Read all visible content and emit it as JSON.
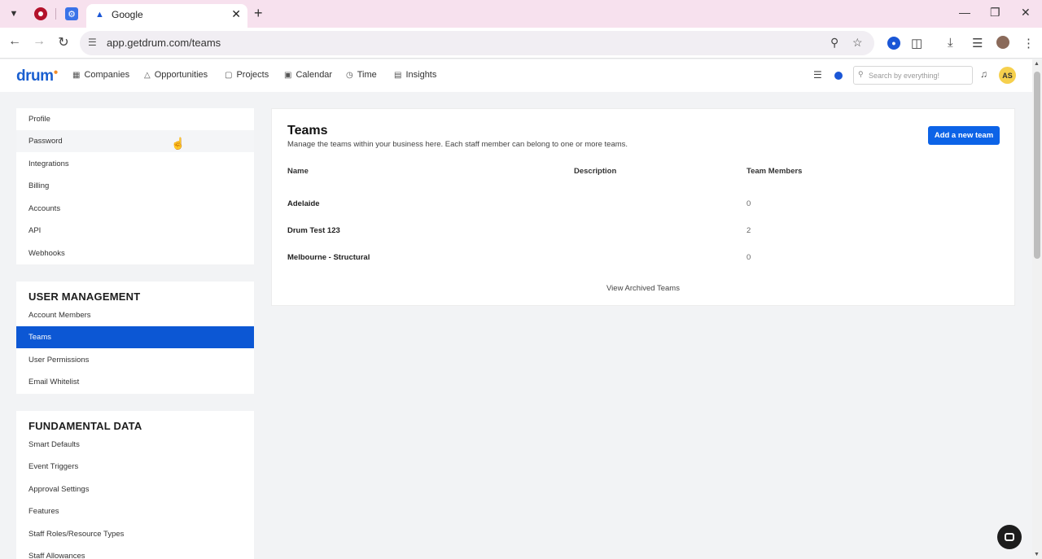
{
  "browser": {
    "tab_title": "Google",
    "url": "app.getdrum.com/teams",
    "icons": [
      "chevron-down-icon",
      "record-icon",
      "settings-icon",
      "close-icon",
      "plus-icon",
      "minimize-icon",
      "restore-icon",
      "back-icon",
      "forward-icon",
      "reload-icon",
      "site-info-icon",
      "zoom-icon",
      "star-icon",
      "password-icon",
      "extensions-icon",
      "download-icon",
      "media-icon",
      "profile-icon",
      "kebab-icon"
    ]
  },
  "header": {
    "logo": "drum",
    "nav": [
      {
        "label": "Companies",
        "icon": "building-icon"
      },
      {
        "label": "Opportunities",
        "icon": "opportunity-icon"
      },
      {
        "label": "Projects",
        "icon": "folder-icon"
      },
      {
        "label": "Calendar",
        "icon": "calendar-icon"
      },
      {
        "label": "Time",
        "icon": "clock-icon"
      },
      {
        "label": "Insights",
        "icon": "insights-icon"
      }
    ],
    "search_placeholder": "Search by everything!",
    "avatar_initials": "AS"
  },
  "sidebar": {
    "account": [
      "Profile",
      "Password",
      "Integrations",
      "Billing",
      "Accounts",
      "API",
      "Webhooks"
    ],
    "user_management": {
      "heading": "USER MANAGEMENT",
      "items": [
        "Account Members",
        "Teams",
        "User Permissions",
        "Email Whitelist"
      ],
      "active": "Teams"
    },
    "fundamental_data": {
      "heading": "FUNDAMENTAL DATA",
      "items": [
        "Smart Defaults",
        "Event Triggers",
        "Approval Settings",
        "Features",
        "Staff Roles/Resource Types",
        "Staff Allowances"
      ]
    }
  },
  "main": {
    "title": "Teams",
    "subtitle": "Manage the teams within your business here. Each staff member can belong to one or more teams.",
    "add_button": "Add a new team",
    "columns": [
      "Name",
      "Description",
      "Team Members"
    ],
    "rows": [
      {
        "name": "Adelaide",
        "description": "",
        "members": "0"
      },
      {
        "name": "Drum Test 123",
        "description": "",
        "members": "2"
      },
      {
        "name": "Melbourne - Structural",
        "description": "",
        "members": "0"
      }
    ],
    "archived_link": "View Archived Teams"
  },
  "colors": {
    "accent": "#0c57d4",
    "button": "#0c63e7",
    "tabbar": "#f7e1ee",
    "avatar": "#f6d04d"
  }
}
